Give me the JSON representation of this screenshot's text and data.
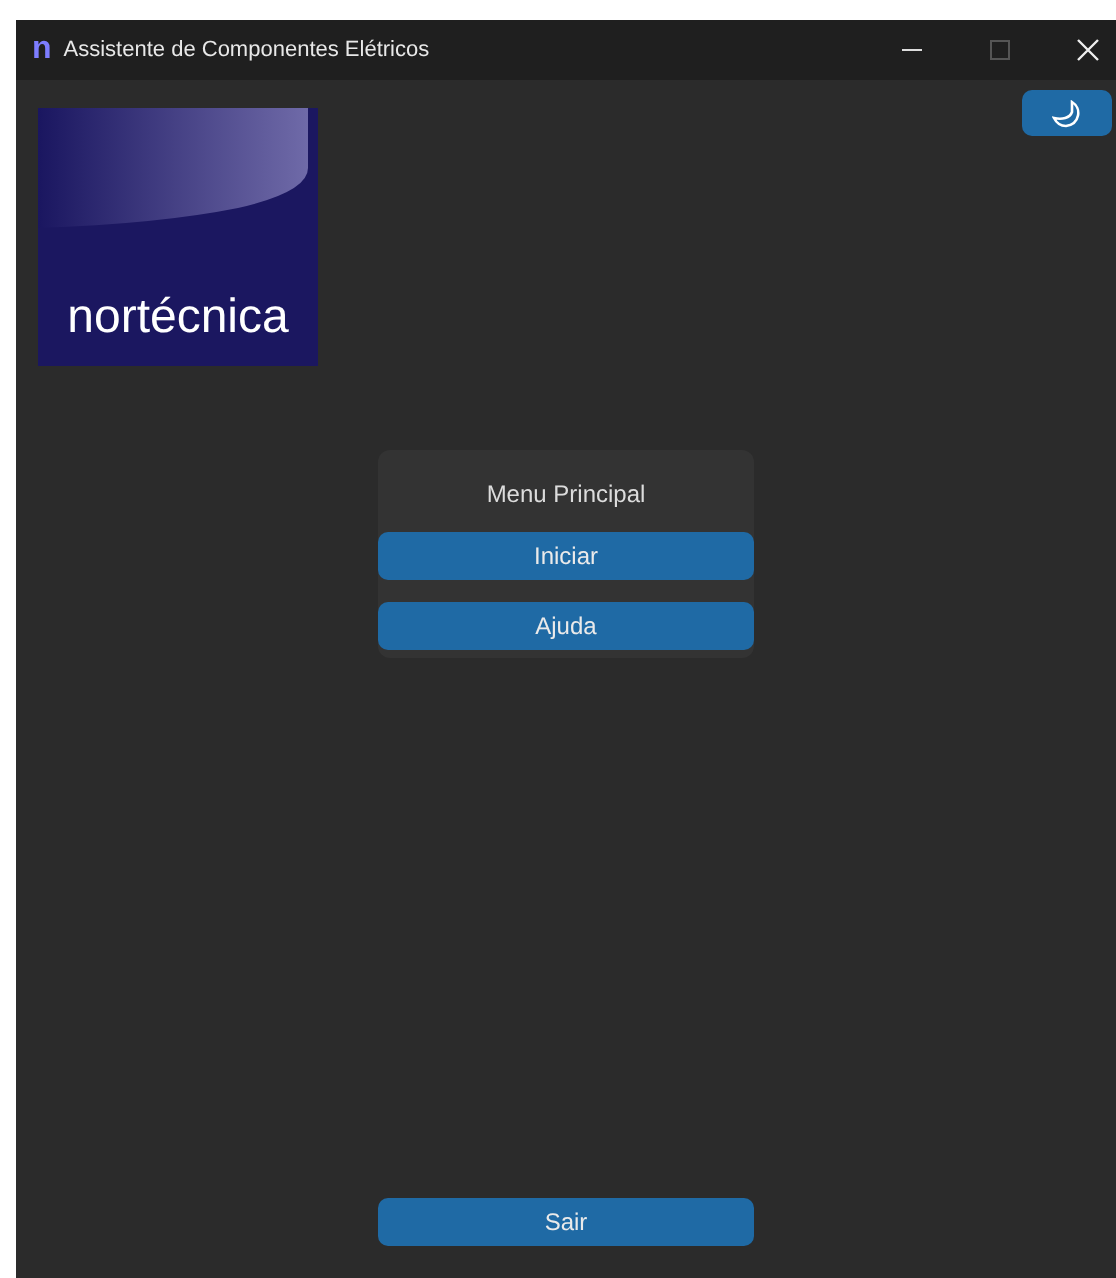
{
  "window": {
    "title": "Assistente de Componentes Elétricos",
    "logo_letter": "n"
  },
  "logo": {
    "text": "nortécnica"
  },
  "menu": {
    "title": "Menu Principal",
    "buttons": [
      "Iniciar",
      "Ajuda"
    ]
  },
  "exit_button": "Sair"
}
